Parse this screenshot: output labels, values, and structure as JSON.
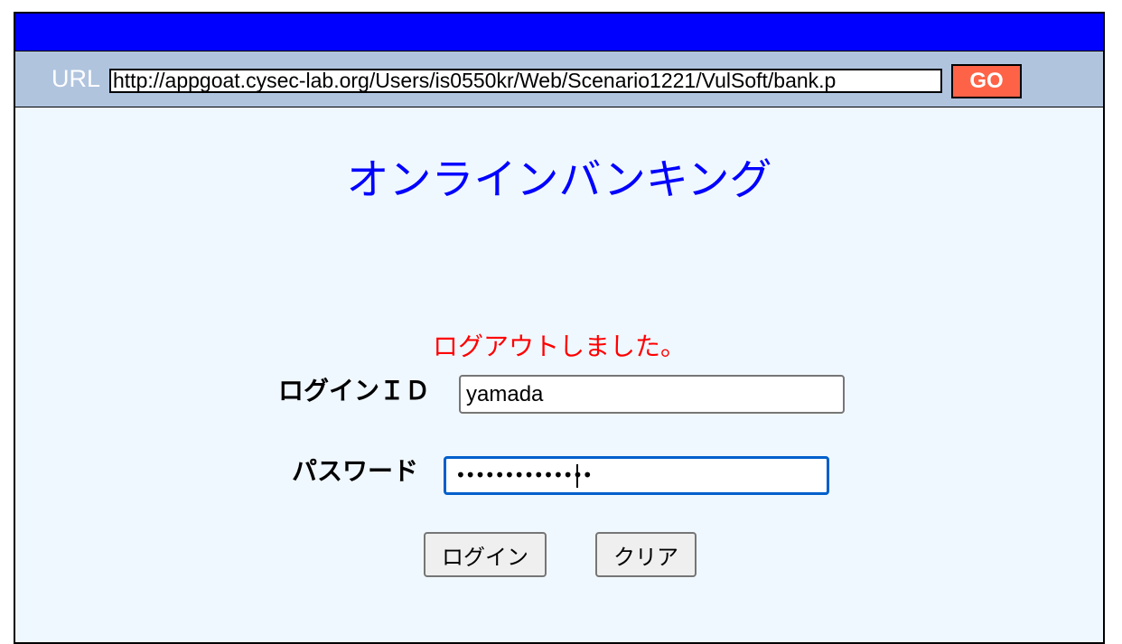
{
  "browser": {
    "url_label": "URL",
    "url_value": "http://appgoat.cysec-lab.org/Users/is0550kr/Web/Scenario1221/VulSoft/bank.p",
    "go_label": "GO"
  },
  "page": {
    "title": "オンラインバンキング",
    "status_message": "ログアウトしました。",
    "status_color": "#ff0000",
    "title_color": "#0000ff"
  },
  "form": {
    "login_id_label": "ログインＩＤ",
    "login_id_value": "yamada",
    "password_label": "パスワード",
    "password_mask": "••••••••••••••",
    "login_button_label": "ログイン",
    "clear_button_label": "クリア"
  },
  "colors": {
    "titlebar": "#0000ff",
    "urlbar": "#b0c4de",
    "go_button": "#ff6347",
    "page_background": "#f0f8ff",
    "focus_ring": "#005fcc"
  }
}
